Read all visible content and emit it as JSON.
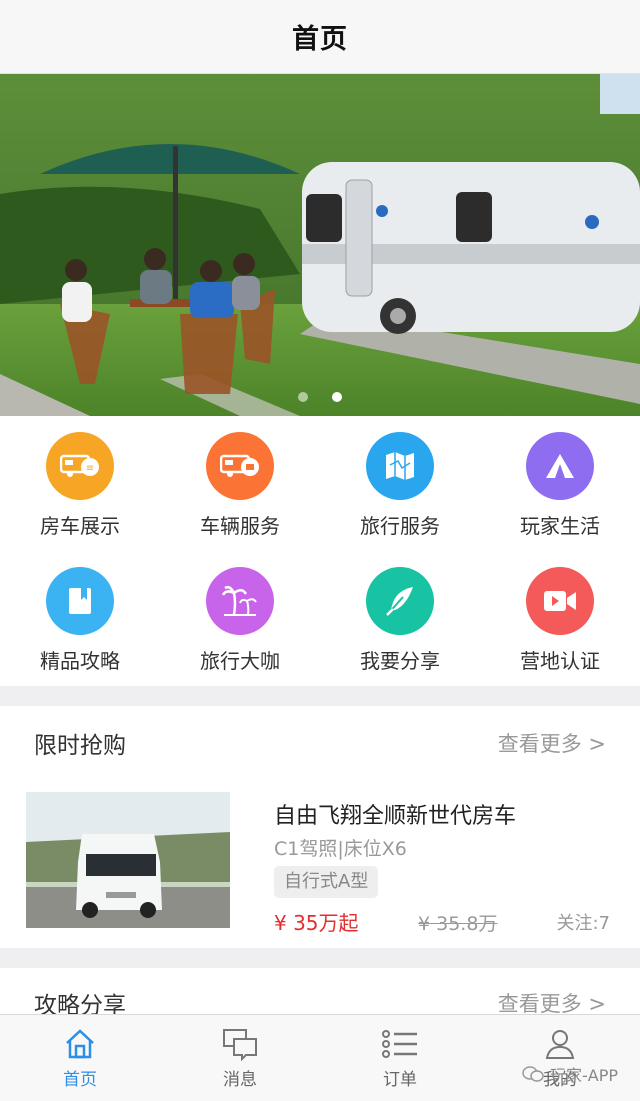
{
  "nav": {
    "title": "首页"
  },
  "banner": {
    "slide_count": 2,
    "active_slide": 2
  },
  "categories": [
    {
      "label": "房车展示",
      "icon": "caravan-icon",
      "color": "#f6a524"
    },
    {
      "label": "车辆服务",
      "icon": "rv-service-icon",
      "color": "#fb7436"
    },
    {
      "label": "旅行服务",
      "icon": "map-icon",
      "color": "#2aa6ef"
    },
    {
      "label": "玩家生活",
      "icon": "tent-icon",
      "color": "#8f6df0"
    },
    {
      "label": "精品攻略",
      "icon": "book-icon",
      "color": "#3bb3f2"
    },
    {
      "label": "旅行大咖",
      "icon": "palm-tree-icon",
      "color": "#c864ea"
    },
    {
      "label": "我要分享",
      "icon": "feather-icon",
      "color": "#18c3a3"
    },
    {
      "label": "营地认证",
      "icon": "video-camera-icon",
      "color": "#f45a5a"
    }
  ],
  "flash_sale": {
    "title": "限时抢购",
    "more": "查看更多 >",
    "product": {
      "name": "自由飞翔全顺新世代房车",
      "spec": "C1驾照|床位X6",
      "tag": "自行式A型",
      "price": "¥ 35万起",
      "old_price": "¥ 35.8万",
      "follow": "关注:7"
    }
  },
  "guide_share": {
    "title": "攻略分享",
    "more": "查看更多 >"
  },
  "tabbar": [
    {
      "label": "首页",
      "icon": "home-icon",
      "active": true
    },
    {
      "label": "消息",
      "icon": "chat-bubble-icon",
      "active": false
    },
    {
      "label": "订单",
      "icon": "list-icon",
      "active": false
    },
    {
      "label": "我的",
      "icon": "user-icon",
      "active": false
    }
  ],
  "watermark": "玩家-APP",
  "colors": {
    "accent": "#2d8ee8",
    "price": "#e12f2f"
  }
}
